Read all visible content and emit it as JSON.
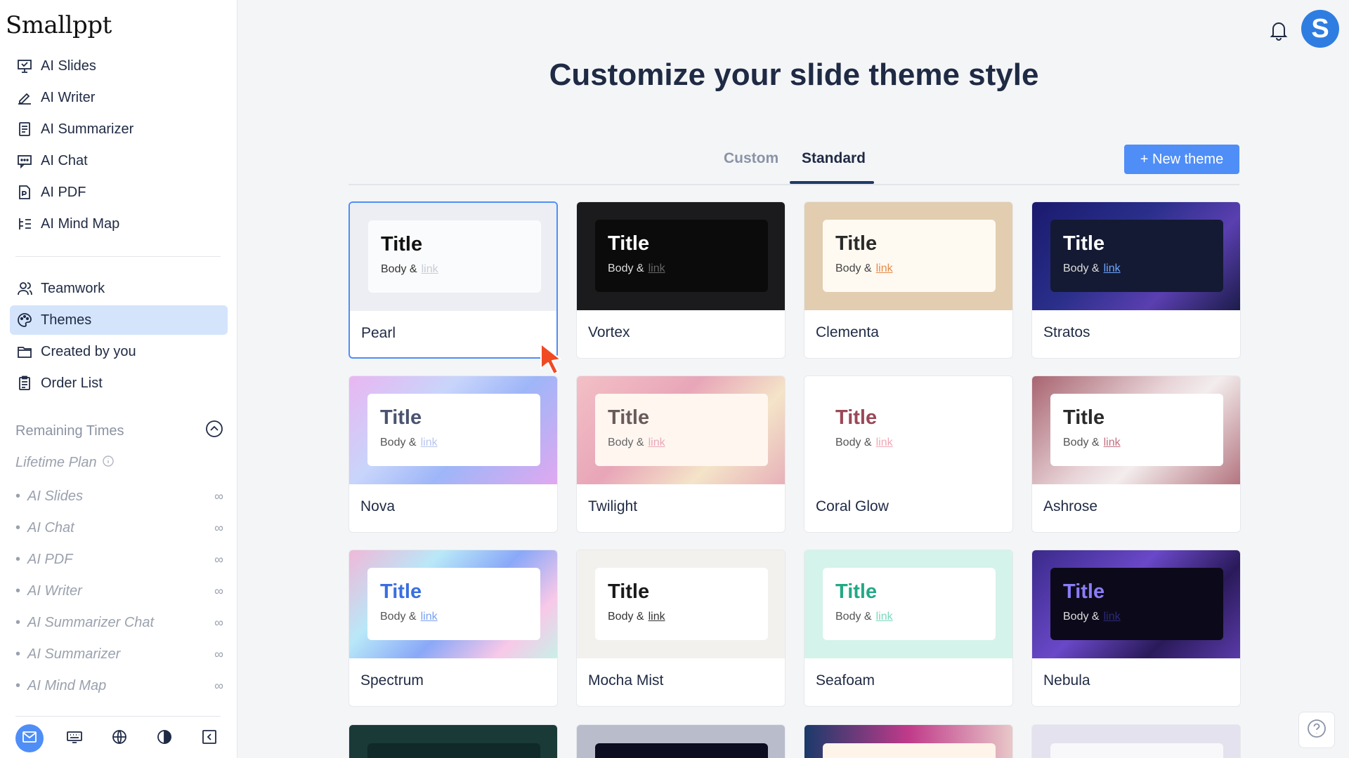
{
  "app": {
    "logo": "Smallppt"
  },
  "sidebar": {
    "primary": [
      {
        "label": "AI Slides",
        "icon": "presentation-icon"
      },
      {
        "label": "AI Writer",
        "icon": "pen-icon"
      },
      {
        "label": "AI Summarizer",
        "icon": "document-icon"
      },
      {
        "label": "AI Chat",
        "icon": "chat-icon"
      },
      {
        "label": "AI PDF",
        "icon": "pdf-icon"
      },
      {
        "label": "AI Mind Map",
        "icon": "mindmap-icon"
      }
    ],
    "secondary": [
      {
        "label": "Teamwork",
        "icon": "users-icon"
      },
      {
        "label": "Themes",
        "icon": "palette-icon",
        "active": true
      },
      {
        "label": "Created by you",
        "icon": "folder-icon"
      },
      {
        "label": "Order List",
        "icon": "clipboard-icon"
      }
    ],
    "remaining_label": "Remaining Times",
    "plan_label": "Lifetime Plan",
    "quota": [
      {
        "name": "AI Slides",
        "value": "∞"
      },
      {
        "name": "AI Chat",
        "value": "∞"
      },
      {
        "name": "AI PDF",
        "value": "∞"
      },
      {
        "name": "AI Writer",
        "value": "∞"
      },
      {
        "name": "AI Summarizer Chat",
        "value": "∞"
      },
      {
        "name": "AI Summarizer",
        "value": "∞"
      },
      {
        "name": "AI Mind Map",
        "value": "∞"
      }
    ]
  },
  "header": {
    "avatar_letter": "S"
  },
  "main": {
    "title": "Customize your slide theme style",
    "tabs": [
      {
        "label": "Custom"
      },
      {
        "label": "Standard",
        "active": true
      }
    ],
    "new_theme_label": "+ New theme",
    "themes": [
      {
        "name": "Pearl",
        "title": "Title",
        "body": "Body &",
        "link": "link",
        "selected": true
      },
      {
        "name": "Vortex",
        "title": "Title",
        "body": "Body &",
        "link": "link"
      },
      {
        "name": "Clementa",
        "title": "Title",
        "body": "Body &",
        "link": "link"
      },
      {
        "name": "Stratos",
        "title": "Title",
        "body": "Body &",
        "link": "link"
      },
      {
        "name": "Nova",
        "title": "Title",
        "body": "Body &",
        "link": "link"
      },
      {
        "name": "Twilight",
        "title": "Title",
        "body": "Body &",
        "link": "link"
      },
      {
        "name": "Coral Glow",
        "title": "Title",
        "body": "Body &",
        "link": "link"
      },
      {
        "name": "Ashrose",
        "title": "Title",
        "body": "Body &",
        "link": "link"
      },
      {
        "name": "Spectrum",
        "title": "Title",
        "body": "Body &",
        "link": "link"
      },
      {
        "name": "Mocha Mist",
        "title": "Title",
        "body": "Body &",
        "link": "link"
      },
      {
        "name": "Seafoam",
        "title": "Title",
        "body": "Body &",
        "link": "link"
      },
      {
        "name": "Nebula",
        "title": "Title",
        "body": "Body &",
        "link": "link"
      }
    ]
  },
  "colors": {
    "accent": "#4f8ef7",
    "active_nav": "#d4e4fb",
    "heading": "#1f2a44"
  }
}
